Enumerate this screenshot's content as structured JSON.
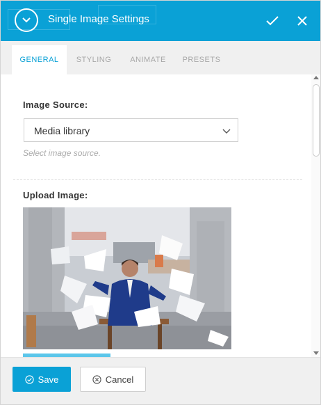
{
  "dialog": {
    "title": "Single Image Settings"
  },
  "tabs": [
    {
      "label": "GENERAL",
      "active": true
    },
    {
      "label": "STYLING",
      "active": false
    },
    {
      "label": "ANIMATE",
      "active": false
    },
    {
      "label": "PRESETS",
      "active": false
    }
  ],
  "general": {
    "image_source_label": "Image Source:",
    "image_source_value": "Media library",
    "image_source_help": "Select image source.",
    "upload_label": "Upload Image:",
    "image_alt": "Man in blue suit sitting at table with papers flying around"
  },
  "footer": {
    "save_label": "Save",
    "cancel_label": "Cancel"
  },
  "colors": {
    "accent": "#0aa1d6",
    "tab_bar": "#f0f0f0"
  },
  "icons": {
    "collapse": "chevron-down-circle-icon",
    "confirm": "check-icon",
    "close": "close-icon",
    "save": "check-circle-icon",
    "cancel": "x-circle-icon"
  }
}
